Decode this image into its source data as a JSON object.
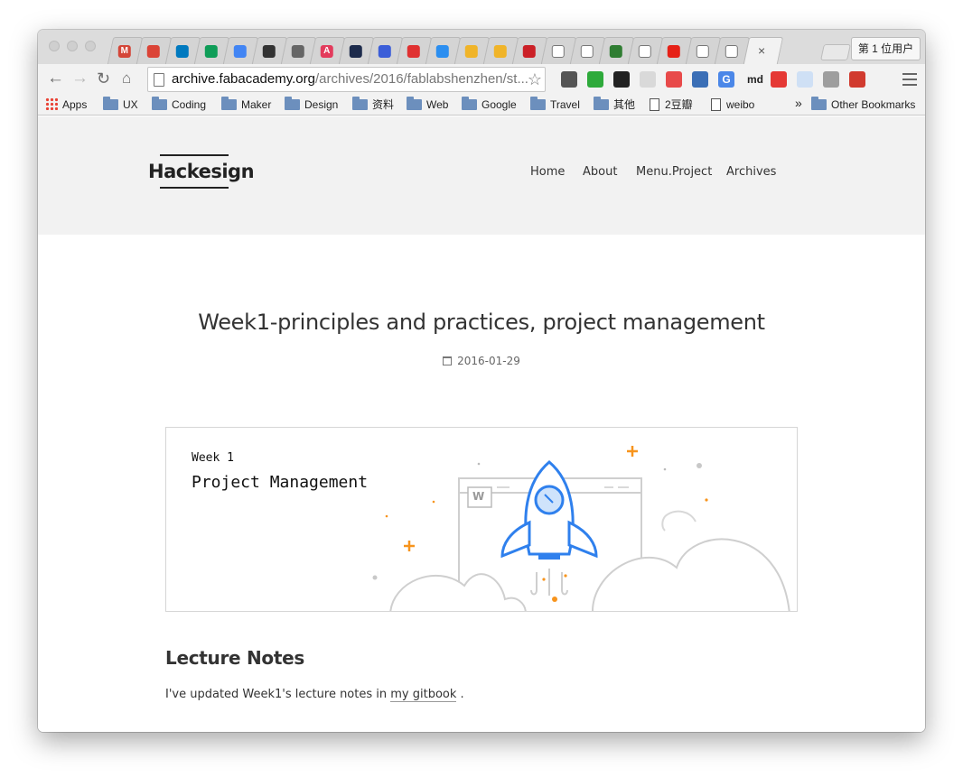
{
  "browser": {
    "profile_button": "第 1 位用户",
    "url_host": "archive.fabacademy.org",
    "url_path": "/archives/2016/fablabshenzhen/st...",
    "extensions": [
      {
        "icon": "evernote-icon",
        "color": "#555555",
        "glyph": ""
      },
      {
        "icon": "shield-green-icon",
        "color": "#2eaa3b",
        "glyph": ""
      },
      {
        "icon": "qr-code-icon",
        "color": "#222222",
        "glyph": ""
      },
      {
        "icon": "pocket-grey-icon",
        "color": "#d9d9d9",
        "glyph": ""
      },
      {
        "icon": "red-blob-icon",
        "color": "#e84a4a",
        "glyph": ""
      },
      {
        "icon": "download-sort-icon",
        "color": "#3b6fb6",
        "glyph": ""
      },
      {
        "icon": "translate-icon",
        "color": "#4b87e8",
        "glyph": "G"
      },
      {
        "icon": "markdown-icon",
        "color": "#f2f2f2",
        "glyph": "md"
      },
      {
        "icon": "adblock-icon",
        "color": "#e53935",
        "glyph": ""
      },
      {
        "icon": "docs-icon",
        "color": "#cfe0f5",
        "glyph": ""
      },
      {
        "icon": "profile-card-icon",
        "color": "#9e9e9e",
        "glyph": ""
      },
      {
        "icon": "red-book-icon",
        "color": "#d13b2f",
        "glyph": ""
      }
    ],
    "tabs": [
      {
        "icon": "gmail-icon",
        "color": "#d44638",
        "glyph": "M"
      },
      {
        "icon": "calendar-icon",
        "color": "#db4437",
        "glyph": ""
      },
      {
        "icon": "trello-icon",
        "color": "#0079bf",
        "glyph": ""
      },
      {
        "icon": "sheets-icon",
        "color": "#0f9d58",
        "glyph": ""
      },
      {
        "icon": "docs-icon",
        "color": "#4285f4",
        "glyph": ""
      },
      {
        "icon": "black-square-icon",
        "color": "#333333",
        "glyph": ""
      },
      {
        "icon": "apple-icon",
        "color": "#666666",
        "glyph": ""
      },
      {
        "icon": "font-a-icon",
        "color": "#e33b5c",
        "glyph": "A"
      },
      {
        "icon": "bookmark-dark-icon",
        "color": "#1d2b4c",
        "glyph": ""
      },
      {
        "icon": "chat-bubble-icon",
        "color": "#3b5ed8",
        "glyph": ""
      },
      {
        "icon": "netease-music-icon",
        "color": "#e03131",
        "glyph": ""
      },
      {
        "icon": "blue-dot-icon",
        "color": "#2b8ef0",
        "glyph": ""
      },
      {
        "icon": "octocat-yellow-icon",
        "color": "#f0b429",
        "glyph": ""
      },
      {
        "icon": "octocat-yellow-icon",
        "color": "#f0b429",
        "glyph": ""
      },
      {
        "icon": "pinterest-icon",
        "color": "#cb2027",
        "glyph": ""
      },
      {
        "icon": "blank-page-icon",
        "color": "#ffffff",
        "glyph": ""
      },
      {
        "icon": "blank-page-icon",
        "color": "#ffffff",
        "glyph": ""
      },
      {
        "icon": "chrome-dev-icon",
        "color": "#2f7d32",
        "glyph": ""
      },
      {
        "icon": "blank-page-icon",
        "color": "#ffffff",
        "glyph": ""
      },
      {
        "icon": "youtube-icon",
        "color": "#e62117",
        "glyph": ""
      },
      {
        "icon": "blank-page-icon",
        "color": "#ffffff",
        "glyph": ""
      },
      {
        "icon": "blank-page-icon",
        "color": "#ffffff",
        "glyph": ""
      }
    ],
    "active_tab_close": "×",
    "bookmarks": [
      {
        "label": "Apps",
        "kind": "apps"
      },
      {
        "label": "UX",
        "kind": "folder"
      },
      {
        "label": "Coding",
        "kind": "folder"
      },
      {
        "label": "Maker",
        "kind": "folder"
      },
      {
        "label": "Design",
        "kind": "folder"
      },
      {
        "label": "资料",
        "kind": "folder"
      },
      {
        "label": "Web",
        "kind": "folder"
      },
      {
        "label": "Google",
        "kind": "folder"
      },
      {
        "label": "Travel",
        "kind": "folder"
      },
      {
        "label": "其他",
        "kind": "folder"
      },
      {
        "label": "2豆瓣",
        "kind": "page"
      },
      {
        "label": "weibo",
        "kind": "page"
      }
    ],
    "bookmarks_overflow": "»",
    "other_bookmarks": "Other Bookmarks"
  },
  "site": {
    "logo": "Hackesign",
    "nav": [
      "Home",
      "About",
      "Menu.Project",
      "Archives"
    ]
  },
  "post": {
    "title": "Week1-principles and practices, project management",
    "date": "2016-01-29",
    "hero_week": "Week 1",
    "hero_title": "Project Management",
    "hero_badge": "W",
    "section_heading": "Lecture Notes",
    "para_prefix": "I've updated Week1's lecture notes in ",
    "para_link": "my gitbook",
    "para_suffix": " ."
  },
  "colors": {
    "accent_orange": "#f7941d",
    "rocket_blue": "#2f80ed",
    "header_bg": "#f2f2f2"
  }
}
